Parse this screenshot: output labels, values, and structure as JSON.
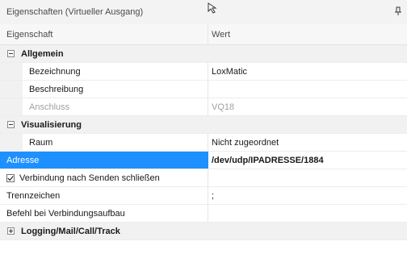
{
  "panel": {
    "title": "Eigenschaften (Virtueller Ausgang)"
  },
  "columns": {
    "name": "Eigenschaft",
    "value": "Wert"
  },
  "groups": {
    "allgemein": "Allgemein",
    "visualisierung": "Visualisierung",
    "logging": "Logging/Mail/Call/Track"
  },
  "rows": {
    "bezeichnung": {
      "label": "Bezeichnung",
      "value": "LoxMatic"
    },
    "beschreibung": {
      "label": "Beschreibung",
      "value": ""
    },
    "anschluss": {
      "label": "Anschluss",
      "value": "VQ18"
    },
    "raum": {
      "label": "Raum",
      "value": "Nicht zugeordnet"
    },
    "adresse": {
      "label": "Adresse",
      "value": "/dev/udp/IPADRESSE/1884"
    },
    "verbindung": {
      "label": "Verbindung nach Senden schließen",
      "checked": true
    },
    "trennzeichen": {
      "label": "Trennzeichen",
      "value": ";"
    },
    "befehl": {
      "label": "Befehl bei Verbindungsaufbau",
      "value": ""
    }
  },
  "colors": {
    "selection": "#1e90ff",
    "group_background": "#f1f1f1"
  }
}
